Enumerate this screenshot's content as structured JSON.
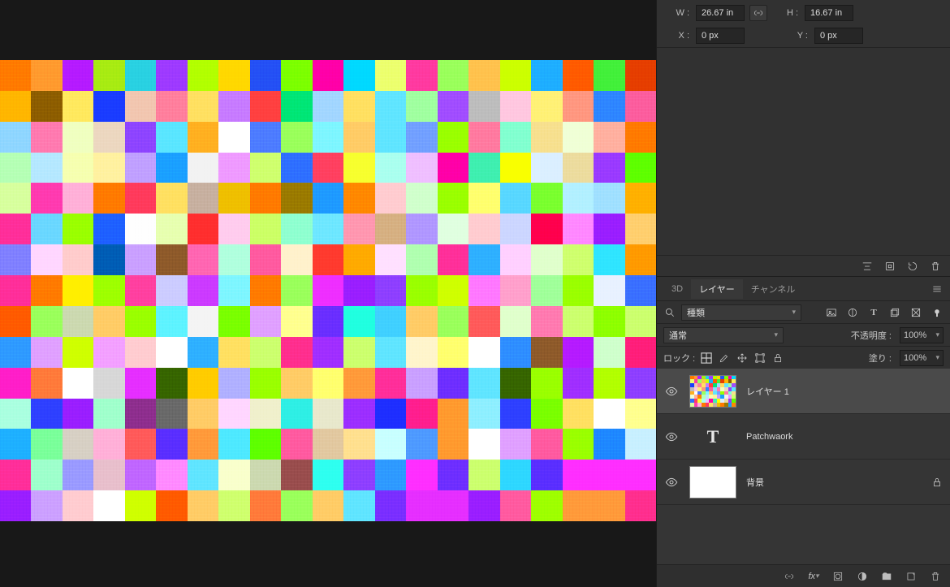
{
  "transform": {
    "w_label": "W :",
    "w_value": "26.67 in",
    "h_label": "H :",
    "h_value": "16.67 in",
    "x_label": "X :",
    "x_value": "0 px",
    "y_label": "Y :",
    "y_value": "0 px"
  },
  "tabs": {
    "t3d": "3D",
    "layers": "レイヤー",
    "channels": "チャンネル"
  },
  "filter": {
    "search_icon": "search-icon",
    "kind_label": "種類",
    "blend_mode": "通常",
    "opacity_label": "不透明度 :",
    "opacity_value": "100%",
    "lock_label": "ロック :",
    "fill_label": "塗り :",
    "fill_value": "100%"
  },
  "layers": [
    {
      "name": "レイヤー 1",
      "type": "image",
      "selected": true
    },
    {
      "name": "Patchwaork",
      "type": "text",
      "selected": false
    },
    {
      "name": "背景",
      "type": "bg",
      "selected": false,
      "locked": true
    }
  ],
  "patch_colors": [
    "#ff7a00",
    "#ff9a2e",
    "#b51aff",
    "#a8eb12",
    "#29d1e2",
    "#9e3aff",
    "#b2ff00",
    "#ffd800",
    "#2450f5",
    "#7cff00",
    "#ff00a8",
    "#00d9ff",
    "#ecff6e",
    "#ff3aa0",
    "#9aff5b",
    "#ffc24d",
    "#ccff00",
    "#1eaeff",
    "#ff5a00",
    "#42f03a",
    "#e63e00",
    "#ffb600",
    "#8d5d00",
    "#ffe95e",
    "#1a3cff",
    "#f2c6b0",
    "#ff7f9d",
    "#ffe061",
    "#c77bff",
    "#ff4040",
    "#00e676",
    "#a2d6ff",
    "#ffe061",
    "#60e5ff",
    "#a0ffa0",
    "#a14dff",
    "#bdbdbd",
    "#ffc7e0",
    "#fff176",
    "#ff9780",
    "#2e86ff",
    "#fc5d9e",
    "#8fd6ff",
    "#ff7ab0",
    "#f0ffc0",
    "#ecd7c0",
    "#8e44ff",
    "#5ae6ff",
    "#ffb020",
    "#ffffff",
    "#4d7cff",
    "#9aff5b",
    "#7ef6ff",
    "#ffcc66",
    "#60e5ff",
    "#72a0ff",
    "#9aff00",
    "#ff7aa0",
    "#82ffd0",
    "#f7e08f",
    "#f0ffd6",
    "#ffb0a0",
    "#ff7a00",
    "#b5ffb5",
    "#b5e8ff",
    "#f6ffb0",
    "#fff1a0",
    "#c0a0ff",
    "#1aa0ff",
    "#f2f2f2",
    "#ef9aff",
    "#cfff6e",
    "#2e6fff",
    "#ff4060",
    "#f7ff2e",
    "#aaffef",
    "#efbfff",
    "#ff00a8",
    "#3fefb0",
    "#f9ff00",
    "#dbefff",
    "#ecdc9e",
    "#9a3aff",
    "#5eff00",
    "#d7ff9e",
    "#ff3ab0",
    "#ffb0d8",
    "#ff7a00",
    "#ff3a5c",
    "#ffe061",
    "#c7b0a0",
    "#efbf00",
    "#ff7a00",
    "#9a7a00",
    "#1e9aff",
    "#ff8800",
    "#ffccd0",
    "#d0ffcc",
    "#9aff00",
    "#ffff6e",
    "#58d7ff",
    "#7aff2e",
    "#b2f0ff",
    "#a0e0ff",
    "#ffb000",
    "#ff2e9a",
    "#6ad7ff",
    "#9aff00",
    "#1e60ff",
    "#fefefe",
    "#e7ffb0",
    "#ff2e2e",
    "#ffccee",
    "#ccff66",
    "#8fffd0",
    "#6ee7ff",
    "#ff97b0",
    "#d6b082",
    "#b097ff",
    "#e0ffe0",
    "#ffccd0",
    "#ccd6ff",
    "#ff004d",
    "#ff88ff",
    "#9a1eff",
    "#ffcf6e",
    "#8080ff",
    "#ffd6ff",
    "#ffcccc",
    "#005db5",
    "#caa0ff",
    "#8e5a2a",
    "#ff66b2",
    "#b0ffde",
    "#ff5aa0",
    "#fff1cc",
    "#ff3a2e",
    "#ffaa00",
    "#ffe0ff",
    "#b0ffb0",
    "#ff2f9a",
    "#2eb0ff",
    "#ffd0ff",
    "#e0ffcc",
    "#cfff6e",
    "#2fe5ff",
    "#ff9a00",
    "#ff2e9a",
    "#ff7a00",
    "#ffef00",
    "#9eff00",
    "#ff40a0",
    "#ccccff",
    "#cc3aff",
    "#7ef6ff",
    "#ff7a00",
    "#9aff5b",
    "#ef2eff",
    "#9a1eff",
    "#8e3fff",
    "#9aff00",
    "#cfff00",
    "#ff78ff",
    "#ffa0cc",
    "#a0ff9a",
    "#9aff00",
    "#e8f1ff",
    "#3a6fff",
    "#ff5a00",
    "#9aff5b",
    "#ccd9b0",
    "#ffcc66",
    "#9aff00",
    "#5ef3ff",
    "#f4f4f4",
    "#7aff00",
    "#e0a0ff",
    "#ffff8f",
    "#6a2eff",
    "#20ffe0",
    "#40d0ff",
    "#ffcc66",
    "#9aff5b",
    "#ff5a5a",
    "#e0ffcc",
    "#ff7ab0",
    "#ccff6e",
    "#8eff00",
    "#ccff6e",
    "#2e9aff",
    "#e0a0ff",
    "#cfff00",
    "#f3a0ff",
    "#ffccd0",
    "#ffffff",
    "#2eb0ff",
    "#ffe061",
    "#ccff6e",
    "#ff2e8e",
    "#a02eff",
    "#ccff6e",
    "#60e5ff",
    "#fff5cc",
    "#ffff6e",
    "#ffffff",
    "#2e8eff",
    "#8e5a2a",
    "#b51aff",
    "#cfffcc",
    "#ff1e7a",
    "#ff1ec9",
    "#ff7a3a",
    "#ffffff",
    "#d7d7d7",
    "#e62eff",
    "#366500",
    "#ffcc00",
    "#b0b0ff",
    "#9aff00",
    "#ffcc66",
    "#ffff6e",
    "#ff9a3a",
    "#ff2e9a",
    "#caa0ff",
    "#6e2eff",
    "#60e5ff",
    "#366500",
    "#9aff00",
    "#a02eff",
    "#b2ff00",
    "#8e3fff",
    "#aaffe0",
    "#2e40ff",
    "#9a1eff",
    "#a0ffcc",
    "#8e2e8e",
    "#696969",
    "#ffcc66",
    "#ffd6ff",
    "#f0f0cc",
    "#2eefe5",
    "#e8e8cc",
    "#9c2eff",
    "#1e2eff",
    "#ff1e8e",
    "#ff9a2e",
    "#8eefff",
    "#2e40ff",
    "#7aff00",
    "#ffe061",
    "#ffffff",
    "#ffff8f",
    "#1eb0ff",
    "#7aff9a",
    "#d7d0c4",
    "#ffb0d8",
    "#ff5a5a",
    "#5a2eff",
    "#ff9a3a",
    "#4ee9ff",
    "#5eff00",
    "#ff5aa0",
    "#e2c8a0",
    "#ffe08f",
    "#c8ffff",
    "#4e9aff",
    "#ff9a2e",
    "#ffffff",
    "#e0a0ff",
    "#ff5aa0",
    "#9aff00",
    "#1e88ff",
    "#c8f0ff",
    "#ff2e9a",
    "#9effcc",
    "#9a9aff",
    "#e8bfcc",
    "#c066ff",
    "#ff8aff",
    "#60e5ff",
    "#f9ffcc",
    "#ccd9b0",
    "#994d4d",
    "#2efff0",
    "#8e3fff",
    "#2e9aff",
    "#ff2eff",
    "#6e2eff",
    "#ccff6e",
    "#2ed7ff",
    "#5a2eff",
    "#ff2eff",
    "#ff2eff",
    "#ff2eff",
    "#9a1eff",
    "#cca0ff",
    "#ffccd0",
    "#ffffff",
    "#cfff00",
    "#ff5a00",
    "#ffcc66",
    "#cfff6e",
    "#ff7a3a",
    "#9aff5b",
    "#ffcc66",
    "#60e5ff",
    "#7a2eff",
    "#e62eff",
    "#e62eff",
    "#9a1eff",
    "#ff5aa0",
    "#9eff00",
    "#ff9a3a",
    "#ff9a3a",
    "#ff2e8e"
  ]
}
